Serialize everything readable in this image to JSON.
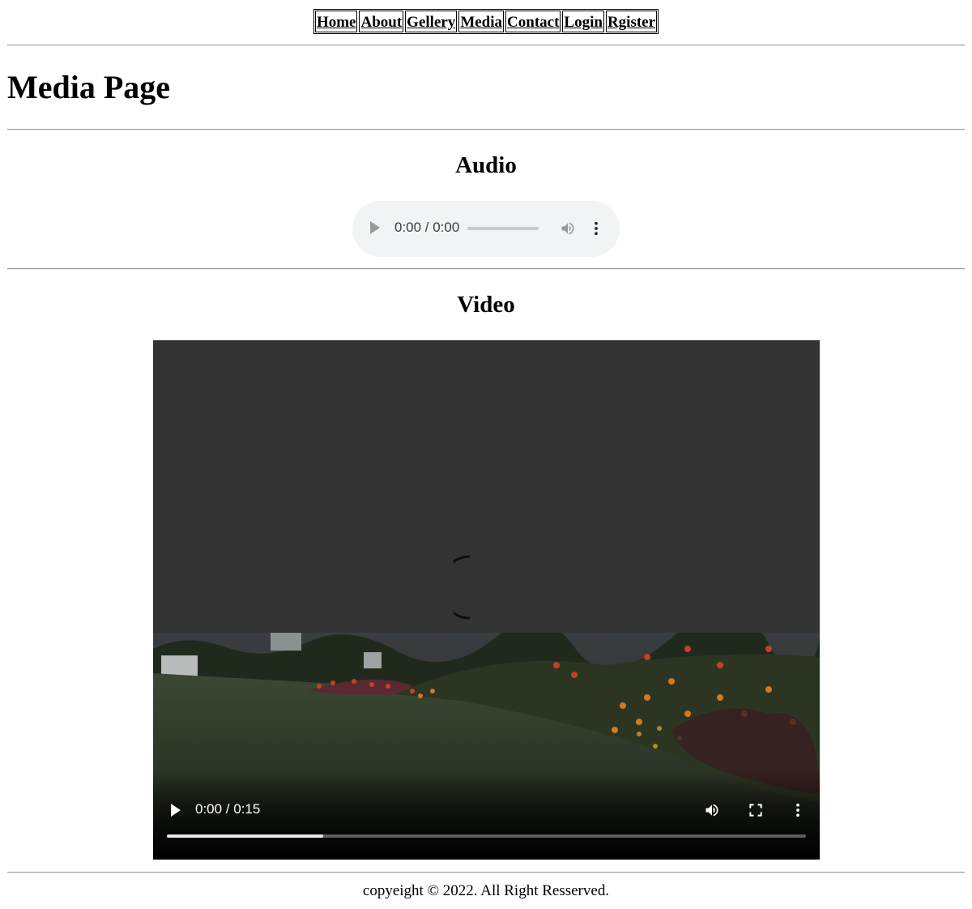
{
  "nav": {
    "items": [
      {
        "label": "Home"
      },
      {
        "label": "About"
      },
      {
        "label": "Gellery"
      },
      {
        "label": "Media"
      },
      {
        "label": "Contact"
      },
      {
        "label": "Login"
      },
      {
        "label": "Rgister"
      }
    ]
  },
  "page_title": "Media Page",
  "audio": {
    "heading": "Audio",
    "time": "0:00 / 0:00",
    "icons": [
      "play-icon",
      "volume-icon",
      "more-options-icon"
    ]
  },
  "video": {
    "heading": "Video",
    "time": "0:00 / 0:15",
    "buffered_fraction": 0.245,
    "icons": [
      "play-icon",
      "volume-icon",
      "fullscreen-icon",
      "more-options-icon",
      "loading-spinner-icon"
    ]
  },
  "footer": {
    "text": "copyeight © 2022. All Right Resserved."
  },
  "colors": {
    "audio_bg": "#f1f3f4",
    "video_bg": "#333333",
    "rule": "#9a9a9a"
  }
}
